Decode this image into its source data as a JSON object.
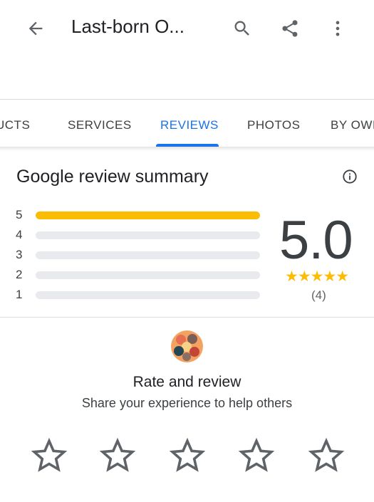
{
  "header": {
    "title": "Last-born O...",
    "back_icon": "arrow-left-icon",
    "search_icon": "search-icon",
    "share_icon": "share-icon",
    "more_icon": "more-vert-icon"
  },
  "tabs": [
    {
      "label": "UCTS",
      "active": false
    },
    {
      "label": "SERVICES",
      "active": false
    },
    {
      "label": "REVIEWS",
      "active": true
    },
    {
      "label": "PHOTOS",
      "active": false
    },
    {
      "label": "BY OWI",
      "active": false
    }
  ],
  "summary": {
    "title": "Google review summary",
    "info_icon": "info-icon",
    "distribution": [
      {
        "stars": "5",
        "fraction": 1.0
      },
      {
        "stars": "4",
        "fraction": 0.0
      },
      {
        "stars": "3",
        "fraction": 0.0
      },
      {
        "stars": "2",
        "fraction": 0.0
      },
      {
        "stars": "1",
        "fraction": 0.0
      }
    ],
    "rating": "5.0",
    "stars_display": "★★★★★",
    "count": "(4)"
  },
  "rate": {
    "title": "Rate and review",
    "subtitle": "Share your experience to help others",
    "star_count": 5,
    "star_icon": "star-outline-icon"
  },
  "colors": {
    "accent": "#1a73e8",
    "star": "#fbbc04",
    "track": "#e8eaed"
  }
}
